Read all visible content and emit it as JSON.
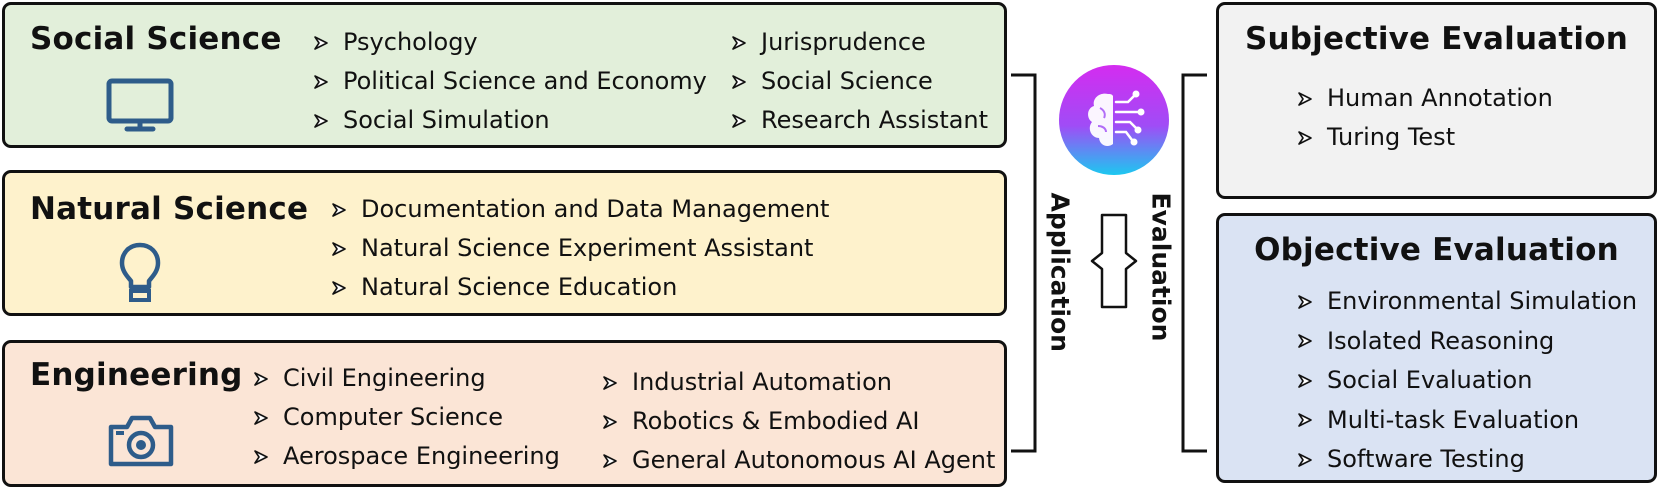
{
  "application_domains": {
    "social_science": {
      "title": "Social Science",
      "icon": "monitor-icon",
      "left_items": [
        "Psychology",
        "Political Science and Economy",
        "Social Simulation"
      ],
      "right_items": [
        "Jurisprudence",
        "Social Science",
        "Research Assistant"
      ],
      "color": "#e2efda"
    },
    "natural_science": {
      "title": "Natural Science",
      "icon": "lightbulb-icon",
      "items": [
        "Documentation and Data Management",
        "Natural Science Experiment Assistant",
        "Natural Science Education"
      ],
      "color": "#fef2cc"
    },
    "engineering": {
      "title": "Engineering",
      "icon": "camera-icon",
      "left_items": [
        "Civil Engineering",
        "Computer Science",
        "Aerospace Engineering"
      ],
      "right_items": [
        "Industrial Automation",
        "Robotics & Embodied AI",
        "General Autonomous AI Agent"
      ],
      "color": "#fbe5d6"
    }
  },
  "center": {
    "application_label": "Application",
    "evaluation_label": "Evaluation",
    "logo_icon": "ai-brain-icon",
    "exchange_icon": "double-arrow-icon"
  },
  "evaluation": {
    "subjective": {
      "title": "Subjective Evaluation",
      "items": [
        "Human Annotation",
        "Turing Test"
      ],
      "color": "#f2f2f2"
    },
    "objective": {
      "title": "Objective Evaluation",
      "items": [
        "Environmental Simulation",
        "Isolated Reasoning",
        "Social Evaluation",
        "Multi-task Evaluation",
        "Software Testing"
      ],
      "color": "#dae3f3"
    }
  },
  "accent_color": "#2e5c8a"
}
